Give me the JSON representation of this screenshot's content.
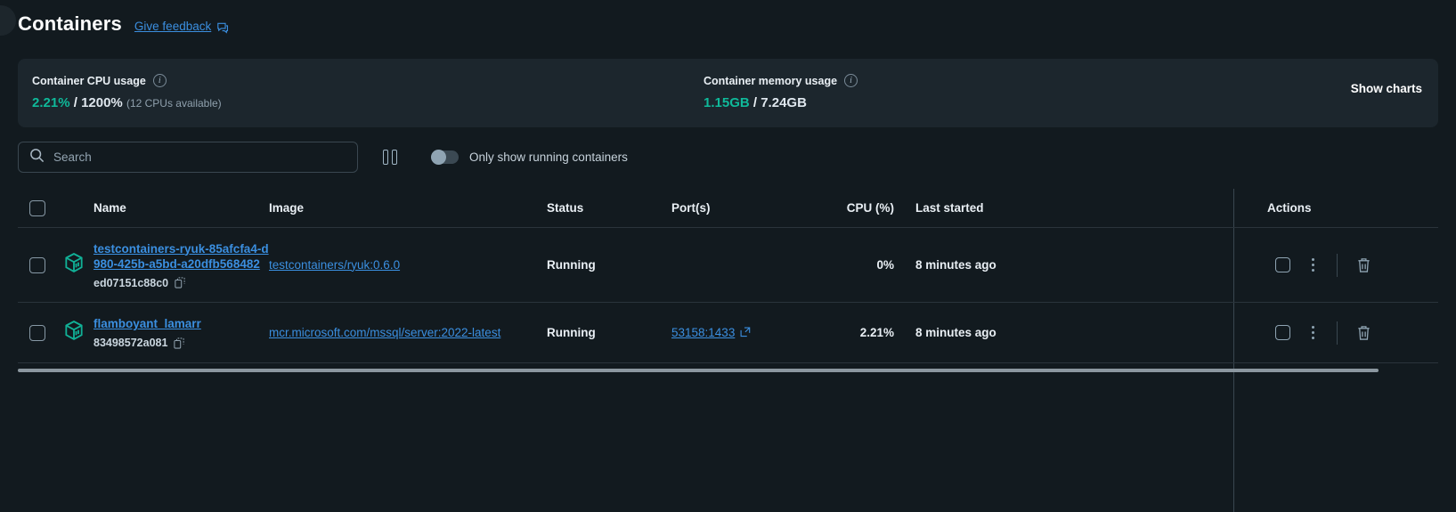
{
  "header": {
    "title": "Containers",
    "feedback_label": "Give feedback",
    "feedback_icon": "speech-bubble-icon"
  },
  "stats": {
    "cpu": {
      "label": "Container CPU usage",
      "info_icon": "info-icon",
      "used": "2.21%",
      "separator": "/",
      "total": "1200%",
      "note": "(12 CPUs available)"
    },
    "memory": {
      "label": "Container memory usage",
      "info_icon": "info-icon",
      "used": "1.15GB",
      "separator": "/",
      "total": "7.24GB"
    },
    "show_charts_label": "Show charts"
  },
  "toolbar": {
    "search_placeholder": "Search",
    "search_value": "",
    "search_icon": "search-icon",
    "pause_icon": "pause-icon",
    "toggle_label": "Only show running containers",
    "toggle_state": "off"
  },
  "table": {
    "columns": {
      "name": "Name",
      "image": "Image",
      "status": "Status",
      "ports": "Port(s)",
      "cpu": "CPU (%)",
      "last_started": "Last started",
      "actions": "Actions"
    },
    "rows": [
      {
        "name": "testcontainers-ryuk-85afcfa4-d980-425b-a5bd-a20dfb568482",
        "container_id": "ed07151c88c0",
        "image": "testcontainers/ryuk:0.6.0",
        "status": "Running",
        "ports": "",
        "cpu": "0%",
        "last_started": "8 minutes ago"
      },
      {
        "name": "flamboyant_lamarr",
        "container_id": "83498572a081",
        "image": "mcr.microsoft.com/mssql/server:2022-latest",
        "status": "Running",
        "ports": "53158:1433",
        "cpu": "2.21%",
        "last_started": "8 minutes ago"
      }
    ]
  },
  "colors": {
    "background": "#121a1f",
    "panel": "#1c262d",
    "link": "#3b8fe0",
    "accent_teal": "#0fb99a",
    "container_icon": "#11b096",
    "text": "#e9eff4",
    "muted": "#8fa0ad"
  }
}
